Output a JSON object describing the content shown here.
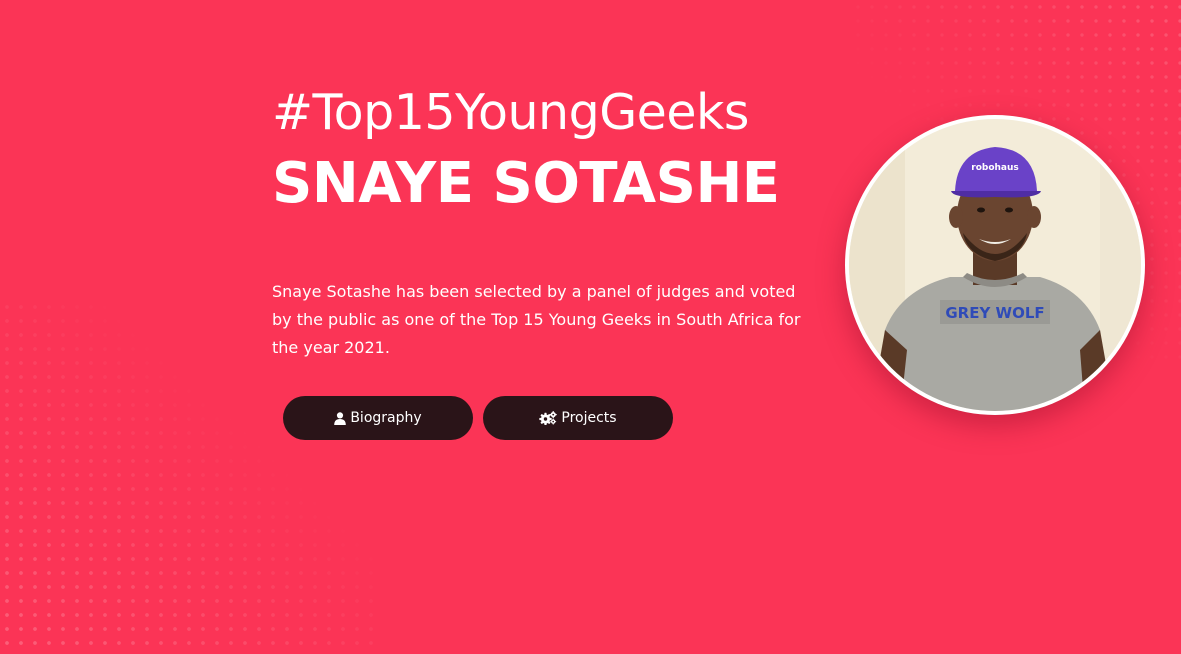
{
  "hero": {
    "hashtag": "#Top15YoungGeeks",
    "name": "SNAYE SOTASHE",
    "description": "Snaye Sotashe has been selected by a panel of judges and voted by the public as one of the Top 15 Young Geeks in South Africa for the year 2021."
  },
  "buttons": {
    "biography": {
      "label": "Biography",
      "icon": "user-icon"
    },
    "projects": {
      "label": "Projects",
      "icon": "cogs-icon"
    }
  },
  "avatar": {
    "cap_text": "robohaus",
    "shirt_text": "GREY WOLF"
  },
  "colors": {
    "background": "#fb3456",
    "button": "#2a1418",
    "text": "#ffffff"
  }
}
